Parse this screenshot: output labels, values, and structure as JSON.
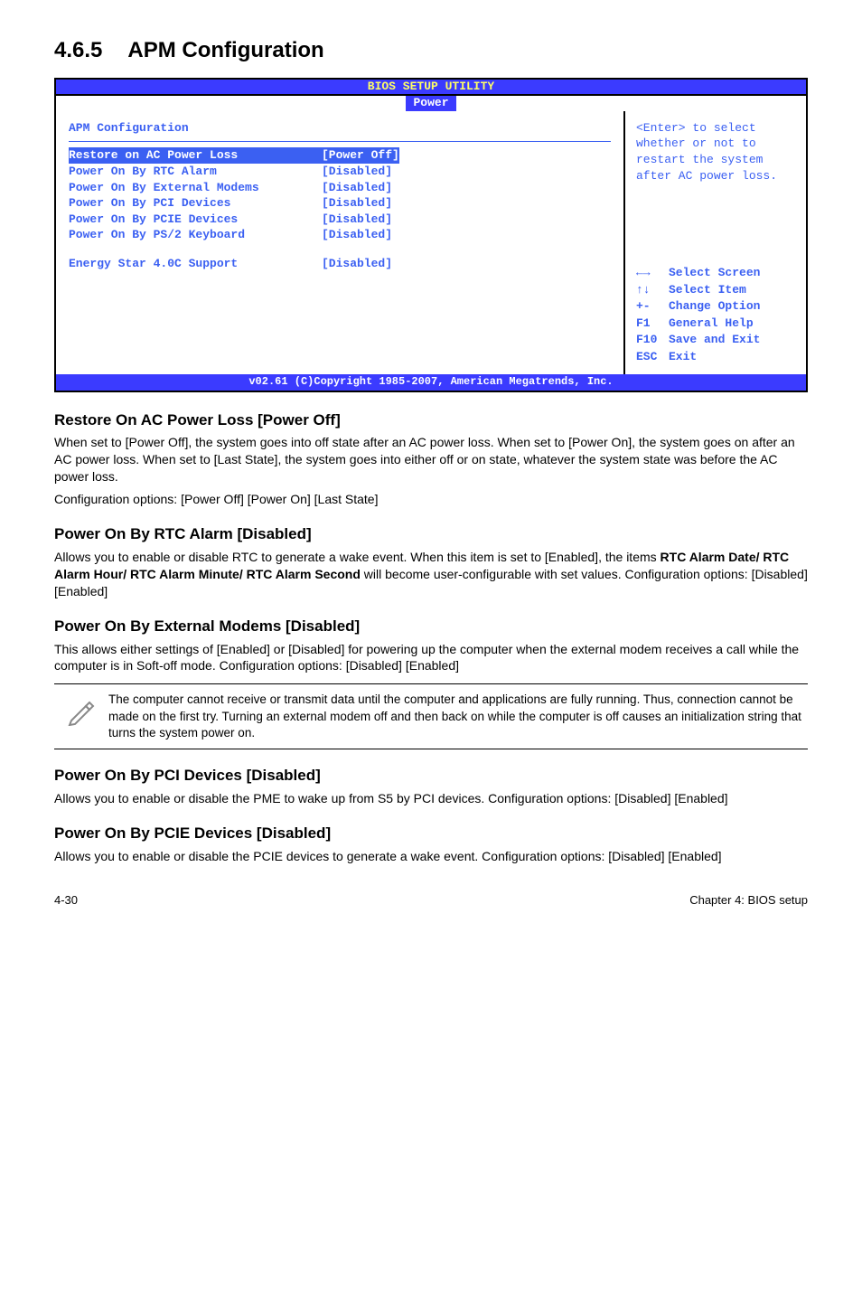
{
  "heading": {
    "number": "4.6.5",
    "title": "APM Configuration"
  },
  "bios": {
    "header": "BIOS SETUP UTILITY",
    "tab": "Power",
    "panel_title": "APM Configuration",
    "rows": [
      {
        "label": "Restore on AC Power Loss",
        "value": "[Power Off]",
        "selected": true
      },
      {
        "label": "Power On By RTC Alarm",
        "value": "[Disabled]",
        "selected": false
      },
      {
        "label": "Power On By External Modems",
        "value": "[Disabled]",
        "selected": false
      },
      {
        "label": "Power On By PCI Devices",
        "value": "[Disabled]",
        "selected": false
      },
      {
        "label": "Power On By PCIE Devices",
        "value": "[Disabled]",
        "selected": false
      },
      {
        "label": "Power On By PS/2 Keyboard",
        "value": "[Disabled]",
        "selected": false
      }
    ],
    "extra_row": {
      "label": "Energy Star 4.0C Support",
      "value": "[Disabled]"
    },
    "hint_lines": [
      "<Enter> to select",
      "whether or not to",
      "restart the system",
      "after AC power loss."
    ],
    "help": [
      {
        "key": "←→",
        "text": "Select Screen"
      },
      {
        "key": "↑↓",
        "text": "Select Item"
      },
      {
        "key": "+-",
        "text": "Change Option"
      },
      {
        "key": "F1",
        "text": "General Help"
      },
      {
        "key": "F10",
        "text": "Save and Exit"
      },
      {
        "key": "ESC",
        "text": "Exit"
      }
    ],
    "footer": "v02.61 (C)Copyright 1985-2007, American Megatrends, Inc."
  },
  "sections": [
    {
      "heading": "Restore On AC Power Loss [Power Off]",
      "paragraphs": [
        "When set to [Power Off], the system goes into off state after an AC power loss. When set to [Power On], the system goes on after an AC power loss. When set to [Last State], the system goes into either off or on state, whatever the system state was before the AC power loss.",
        "Configuration options: [Power Off] [Power On] [Last State]"
      ]
    },
    {
      "heading": "Power On By RTC Alarm [Disabled]",
      "paragraphs_html": "Allows you to enable or disable RTC to generate a wake event. When this item is set to [Enabled], the items <b>RTC Alarm Date/ RTC Alarm Hour/ RTC Alarm Minute/ RTC Alarm Second</b> will become user-configurable with set values. Configuration options: [Disabled] [Enabled]"
    },
    {
      "heading": "Power On By External Modems [Disabled]",
      "paragraphs": [
        "This allows either settings of [Enabled] or [Disabled] for powering up the computer when the external modem receives a call while the computer is in Soft-off mode. Configuration options: [Disabled] [Enabled]"
      ]
    }
  ],
  "note": "The computer cannot receive or transmit data until the computer and applications are fully running. Thus, connection cannot be made on the first try. Turning an external modem off and then back on while the computer is off causes an initialization string that turns the system power on.",
  "sections_after": [
    {
      "heading": "Power On By PCI Devices [Disabled]",
      "paragraphs": [
        "Allows you to enable or disable the PME to wake up from S5 by PCI devices. Configuration options: [Disabled] [Enabled]"
      ]
    },
    {
      "heading": "Power On By PCIE Devices [Disabled]",
      "paragraphs": [
        "Allows you to enable or disable the PCIE devices to generate a wake event. Configuration options: [Disabled] [Enabled]"
      ]
    }
  ],
  "footer": {
    "left": "4-30",
    "right": "Chapter 4: BIOS setup"
  }
}
